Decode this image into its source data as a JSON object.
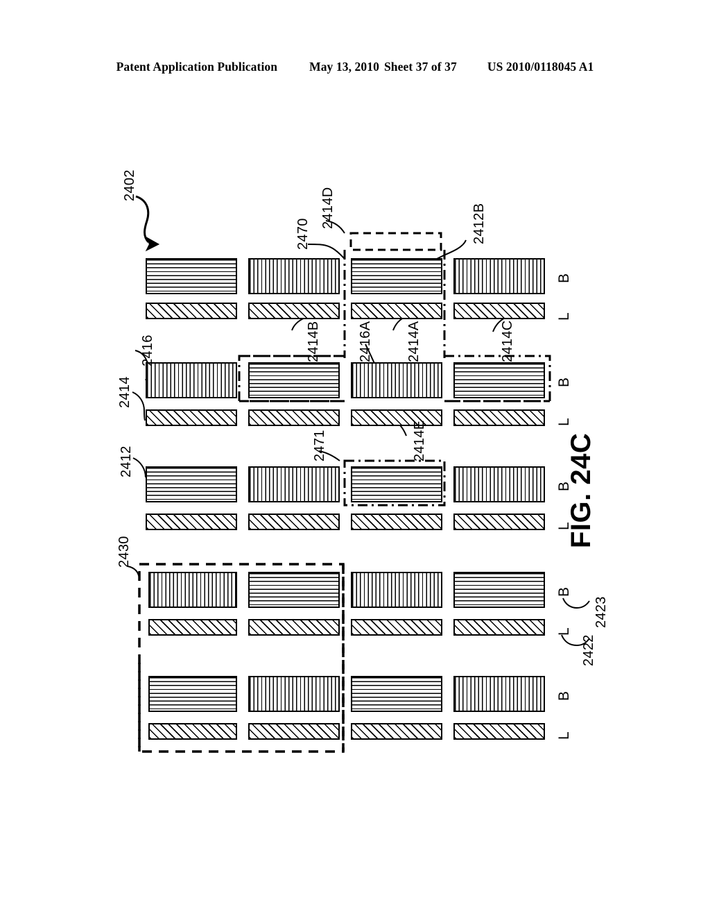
{
  "header": {
    "publication": "Patent Application Publication",
    "date": "May 13, 2010",
    "sheet": "Sheet 37 of 37",
    "number": "US 2010/0118045 A1"
  },
  "figure": {
    "caption": "FIG. 24C",
    "main_ref": "2402",
    "labels": [
      {
        "id": "ref-2402",
        "text": "2402"
      },
      {
        "id": "ref-2470",
        "text": "2470"
      },
      {
        "id": "ref-2414D",
        "text": "2414D"
      },
      {
        "id": "ref-2412B",
        "text": "2412B"
      },
      {
        "id": "ref-2414B",
        "text": "2414B"
      },
      {
        "id": "ref-2416A",
        "text": "2416A"
      },
      {
        "id": "ref-2414A",
        "text": "2414A"
      },
      {
        "id": "ref-2414C",
        "text": "2414C"
      },
      {
        "id": "ref-2414",
        "text": "2414"
      },
      {
        "id": "ref-2416",
        "text": "2416"
      },
      {
        "id": "ref-2412",
        "text": "2412"
      },
      {
        "id": "ref-2471",
        "text": "2471"
      },
      {
        "id": "ref-2414E",
        "text": "2414E"
      },
      {
        "id": "ref-2430",
        "text": "2430"
      },
      {
        "id": "ref-2422",
        "text": "2422"
      },
      {
        "id": "ref-2423",
        "text": "2423"
      }
    ],
    "row_markers": [
      {
        "row": 1,
        "b": "B",
        "l": "L"
      },
      {
        "row": 2,
        "b": "B",
        "l": "L"
      },
      {
        "row": 3,
        "b": "B",
        "l": "L"
      },
      {
        "row": 4,
        "b": "B",
        "l": "L"
      },
      {
        "row": 5,
        "b": "B",
        "l": "L"
      }
    ],
    "grid": {
      "columns": 4,
      "rows": 5,
      "cell_patterns": [
        [
          "horizontal",
          "vertical",
          "horizontal",
          "vertical"
        ],
        [
          "vertical",
          "horizontal",
          "vertical",
          "horizontal"
        ],
        [
          "horizontal",
          "vertical",
          "horizontal",
          "vertical"
        ],
        [
          "vertical",
          "horizontal",
          "vertical",
          "horizontal"
        ],
        [
          "horizontal",
          "vertical",
          "horizontal",
          "vertical"
        ]
      ],
      "line_layer_pattern": "diagonal"
    }
  }
}
